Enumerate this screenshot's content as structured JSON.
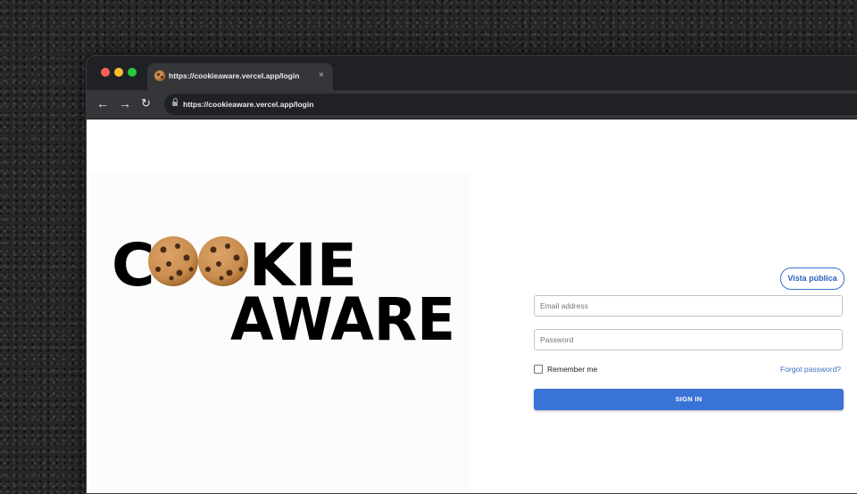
{
  "browser": {
    "tab_title": "https://cookieaware.vercel.app/login",
    "tab_close": "×",
    "url": "https://cookieaware.vercel.app/login",
    "nav": {
      "back": "←",
      "forward": "→",
      "reload": "↻"
    }
  },
  "logo": {
    "line1_prefix": "C",
    "line1_suffix": "KIE",
    "line2": "AWARE",
    "icon": "cookie-icon",
    "colors": {
      "text": "#000000",
      "cookie": "#c98c4d",
      "chips": "#4a2b12"
    }
  },
  "header": {
    "public_view_label": "Vista pública"
  },
  "login_form": {
    "email_placeholder": "Email address",
    "password_placeholder": "Password",
    "remember_label": "Remember me",
    "forgot_label": "Forgot password?",
    "signin_label": "SIGN IN",
    "accent": "#3a73d6"
  }
}
